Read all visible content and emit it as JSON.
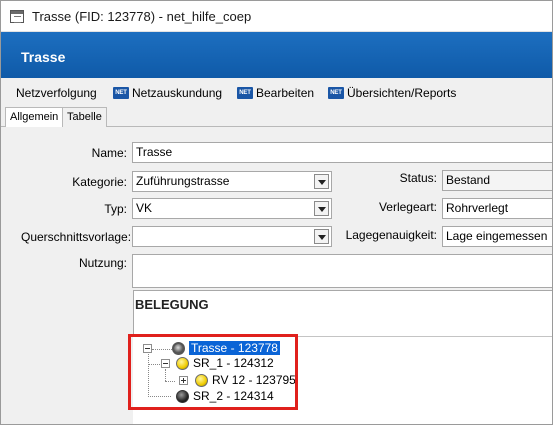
{
  "window": {
    "title": "Trasse (FID: 123778) - net_hilfe_coep"
  },
  "header": {
    "title": "Trasse"
  },
  "menu": {
    "items": [
      {
        "label": "Netzverfolgung",
        "icon": ""
      },
      {
        "label": "Netzauskundung",
        "icon": "net-icon"
      },
      {
        "label": "Bearbeiten",
        "icon": "net-icon"
      },
      {
        "label": "Übersichten/Reports",
        "icon": "net-icon"
      }
    ],
    "net_icon_text": "NET"
  },
  "tabs": [
    {
      "label": "Allgemein",
      "active": true
    },
    {
      "label": "Tabelle",
      "active": false
    }
  ],
  "form": {
    "name_label": "Name:",
    "name_value": "Trasse",
    "kategorie_label": "Kategorie:",
    "kategorie_value": "Zuführungstrasse",
    "typ_label": "Typ:",
    "typ_value": "VK",
    "querschnitt_label": "Querschnittsvorlage:",
    "querschnitt_value": "",
    "nutzung_label": "Nutzung:",
    "nutzung_value": "",
    "status_label": "Status:",
    "status_value": "Bestand",
    "verlegeart_label": "Verlegeart:",
    "verlegeart_value": "Rohrverlegt",
    "lagegenauigkeit_label": "Lagegenauigkeit:",
    "lagegenauigkeit_value": "Lage eingemessen"
  },
  "belegung": {
    "title": "BELEGUNG",
    "tree": [
      {
        "label": "Trasse - 123778",
        "icon": "trasse-icon",
        "selected": true
      },
      {
        "label": "SR_1 - 124312",
        "icon": "yellow-dot-icon"
      },
      {
        "label": "RV 12 - 123795",
        "icon": "yellow-dot-icon"
      },
      {
        "label": "SR_2 - 124314",
        "icon": "dark-dot-icon"
      }
    ]
  },
  "colors": {
    "header_blue": "#1462b4",
    "selection_blue": "#0a64d6",
    "highlight_red": "#e0201c"
  }
}
